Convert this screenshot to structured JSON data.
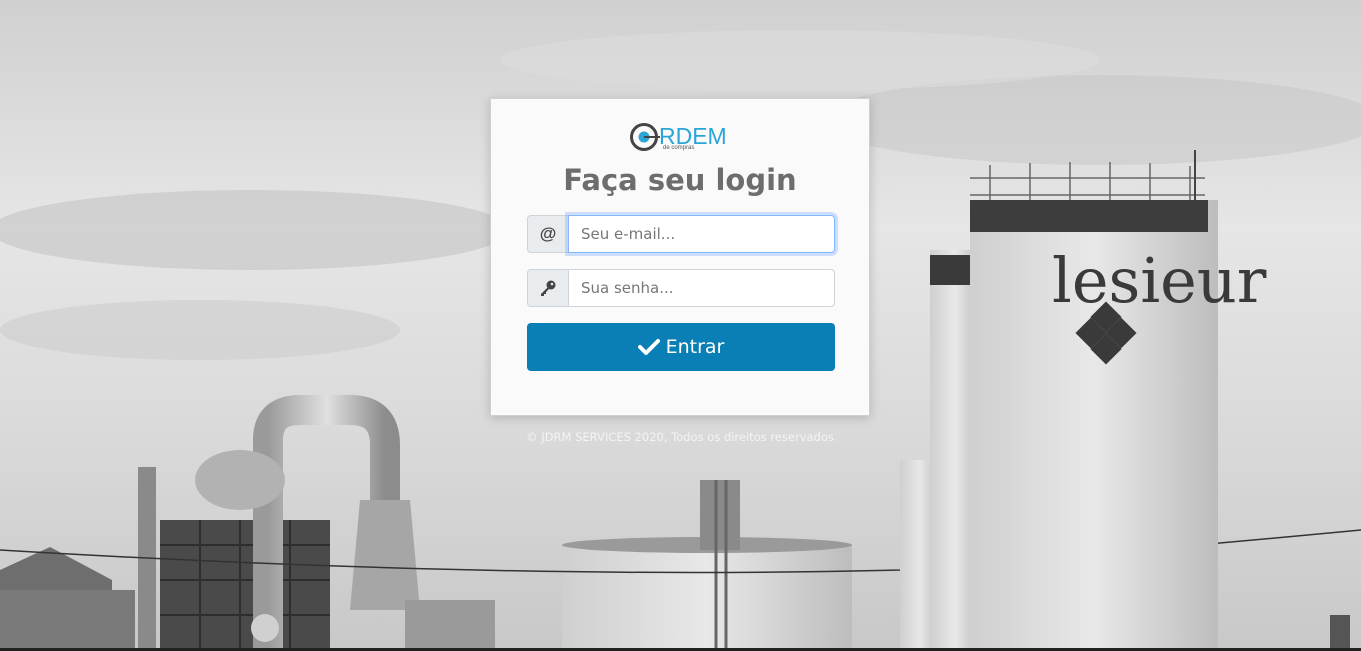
{
  "background": {
    "signage_text": "lesieur"
  },
  "logo": {
    "word": "RDEM",
    "subtitle": "de compras",
    "accent_color": "#2aa5d8"
  },
  "login": {
    "title": "Faça seu login",
    "email": {
      "icon": "at-icon",
      "addon_text": "@",
      "placeholder": "Seu e-mail..."
    },
    "password": {
      "icon": "key-icon",
      "placeholder": "Sua senha..."
    },
    "submit": {
      "icon": "check-icon",
      "label": "Entrar",
      "color": "#0a7fb5"
    }
  },
  "footer": {
    "text": "© JDRM SERVICES 2020, Todos os direitos reservados"
  }
}
